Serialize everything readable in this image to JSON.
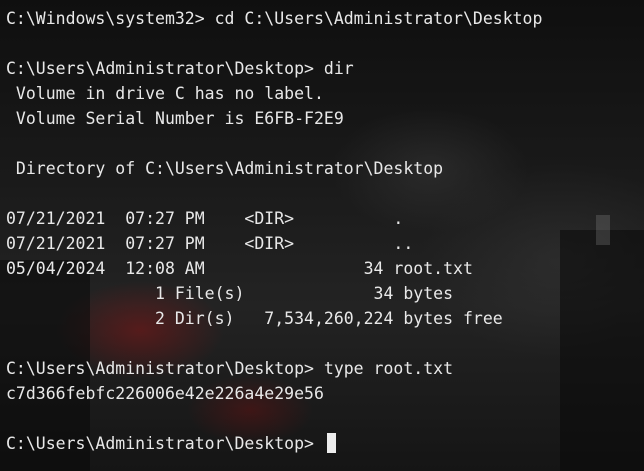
{
  "terminal": {
    "lines": [
      "C:\\Windows\\system32> cd C:\\Users\\Administrator\\Desktop",
      "",
      "C:\\Users\\Administrator\\Desktop> dir",
      " Volume in drive C has no label.",
      " Volume Serial Number is E6FB-F2E9",
      "",
      " Directory of C:\\Users\\Administrator\\Desktop",
      "",
      "07/21/2021  07:27 PM    <DIR>          .",
      "07/21/2021  07:27 PM    <DIR>          ..",
      "05/04/2024  12:08 AM                34 root.txt",
      "               1 File(s)             34 bytes",
      "               2 Dir(s)   7,534,260,224 bytes free",
      "",
      "C:\\Users\\Administrator\\Desktop> type root.txt",
      "c7d366febfc226006e42e226a4e29e56",
      "",
      "C:\\Users\\Administrator\\Desktop> "
    ]
  }
}
